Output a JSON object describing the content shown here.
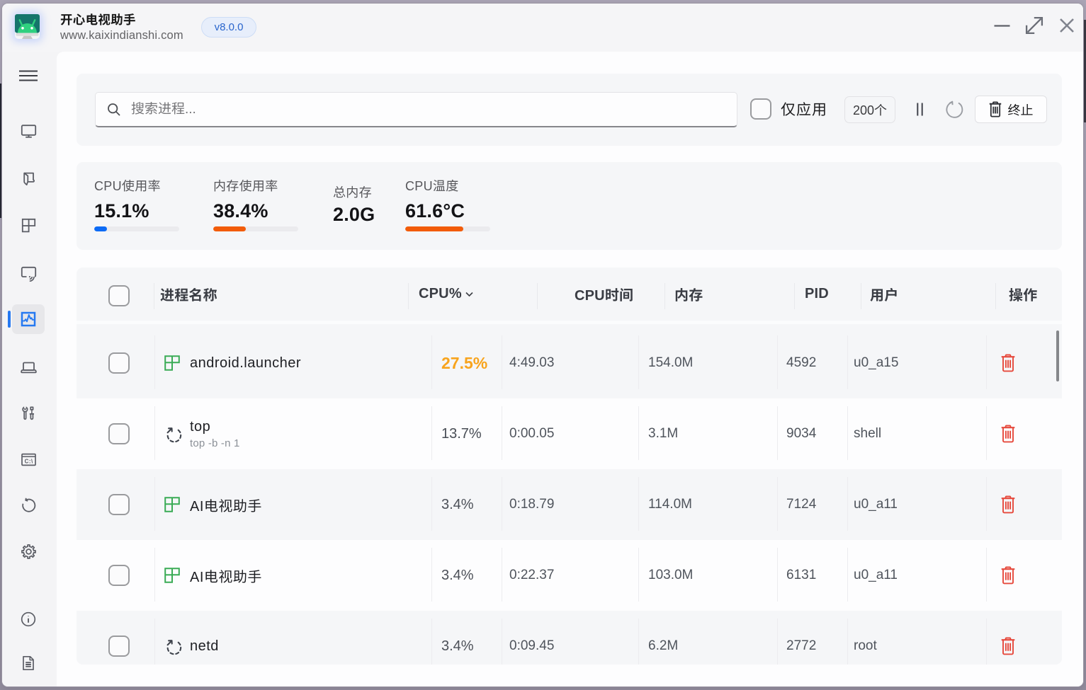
{
  "window": {
    "title": "开心电视助手",
    "subtitle": "www.kaixindianshi.com",
    "version_badge": "v8.0.0",
    "controls": {
      "minimize": "minimize",
      "maximize": "maximize",
      "close": "close"
    }
  },
  "sidebar": {
    "items": [
      {
        "name": "menu"
      },
      {
        "name": "tv-screen"
      },
      {
        "name": "apps-book"
      },
      {
        "name": "layout-grid"
      },
      {
        "name": "screen-cast"
      },
      {
        "name": "process-monitor",
        "selected": true
      },
      {
        "name": "device-laptop"
      },
      {
        "name": "tools"
      },
      {
        "name": "terminal"
      },
      {
        "name": "history-refresh"
      },
      {
        "name": "settings"
      },
      {
        "name": "info"
      },
      {
        "name": "logs-document"
      }
    ]
  },
  "toolbar": {
    "search_placeholder": "搜索进程...",
    "search_value": "",
    "apps_only_label": "仅应用",
    "apps_only_checked": false,
    "process_count": "200个",
    "kill_label": "终止"
  },
  "stats": [
    {
      "label": "CPU使用率",
      "value": "15.1%",
      "percent": 15.1,
      "bar_color": "#0d6bf5",
      "has_bar": true
    },
    {
      "label": "内存使用率",
      "value": "38.4%",
      "percent": 38.4,
      "bar_color": "#f25c0a",
      "has_bar": true
    },
    {
      "label": "总内存",
      "value": "2.0G",
      "has_bar": false
    },
    {
      "label": "CPU温度",
      "value": "61.6°C",
      "percent": 61.6,
      "bar_fill_percent": 68,
      "bar_color": "#f25c0a",
      "has_bar": true
    }
  ],
  "table": {
    "headers": [
      "进程名称",
      "CPU%",
      "CPU时间",
      "内存",
      "PID",
      "用户",
      "操作"
    ],
    "sorted_by": "CPU%",
    "rows": [
      {
        "name": "android.launcher",
        "sub": "",
        "icon": "app",
        "cpu": "27.5%",
        "cpu_hot": true,
        "time": "4:49.03",
        "mem": "154.0M",
        "pid": "4592",
        "user": "u0_a15"
      },
      {
        "name": "top",
        "sub": "top -b -n 1",
        "icon": "proc",
        "cpu": "13.7%",
        "cpu_hot": false,
        "time": "0:00.05",
        "mem": "3.1M",
        "pid": "9034",
        "user": "shell"
      },
      {
        "name": "AI电视助手",
        "sub": "",
        "icon": "app",
        "cpu": "3.4%",
        "cpu_hot": false,
        "time": "0:18.79",
        "mem": "114.0M",
        "pid": "7124",
        "user": "u0_a11"
      },
      {
        "name": "AI电视助手",
        "sub": "",
        "icon": "app",
        "cpu": "3.4%",
        "cpu_hot": false,
        "time": "0:22.37",
        "mem": "103.0M",
        "pid": "6131",
        "user": "u0_a11"
      },
      {
        "name": "netd",
        "sub": "",
        "icon": "proc",
        "cpu": "3.4%",
        "cpu_hot": false,
        "time": "0:09.45",
        "mem": "6.2M",
        "pid": "2772",
        "user": "root"
      }
    ]
  },
  "colors": {
    "accent_blue": "#2679f1",
    "progress_blue": "#0d6bf5",
    "progress_orange": "#f25c0a",
    "cpu_hot": "#f7a61f",
    "trash_red": "#e6493c",
    "app_icon_green": "#3aab55"
  }
}
